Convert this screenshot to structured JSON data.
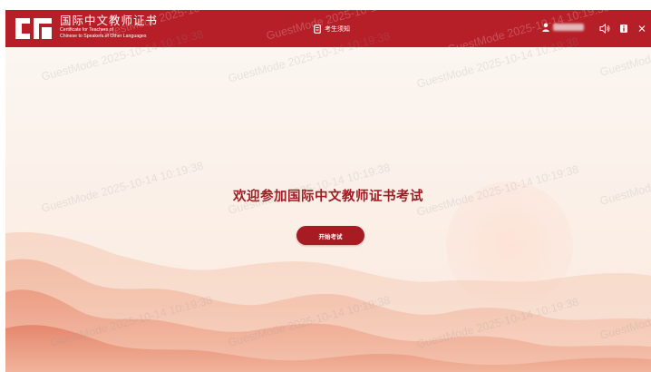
{
  "header": {
    "logo_title": "国际中文教师证书",
    "logo_sub_line1": "Certificate for Teachers of",
    "logo_sub_line2": "Chinese to Speakers of Other Languages",
    "notice_label": "考生须知",
    "icons": [
      "logo-mark",
      "document-icon",
      "user-icon",
      "speaker-icon",
      "info-icon",
      "close-icon"
    ]
  },
  "main": {
    "welcome_title": "欢迎参加国际中文教师证书考试",
    "start_button_label": "开始考试"
  },
  "watermark": {
    "text": "GuestMode 2025-10-14 10:19:38"
  },
  "colors": {
    "header_bg": "#b61f27",
    "title_text": "#9d1d23",
    "button_bg": "#a61c22",
    "background": "#fbf5ef"
  }
}
